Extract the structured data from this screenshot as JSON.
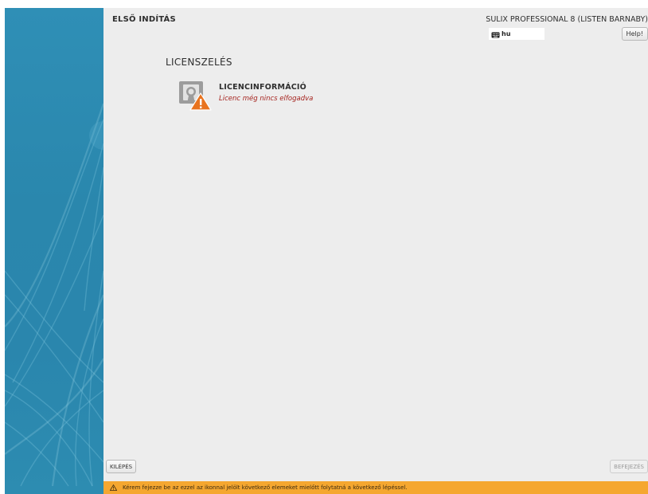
{
  "window": {
    "title": "ELSŐ INDÍTÁS",
    "product": "SULIX PROFESSIONAL 8 (LISTEN BARNABY)",
    "keyboard_layout": "hu",
    "help_label": "Help!"
  },
  "section": {
    "title": "LICENSZELÉS"
  },
  "spoke": {
    "title": "LICENCINFORMÁCIÓ",
    "status": "Licenc még nincs elfogadva",
    "icon": "license-warning-icon"
  },
  "footer": {
    "quit_label": "KILÉPÉS",
    "finish_label": "BEFEJEZÉS"
  },
  "warning_bar": {
    "text": "Kérem fejezze be az ezzel az ikonnal jelölt következő elemeket mielőtt folytatná a következő lépéssel.",
    "color": "#f5a730"
  },
  "colors": {
    "sidebar": "#2a87ad",
    "main_bg": "#ededed",
    "warning_text": "#a5221d",
    "warning_icon": "#e8731f"
  }
}
